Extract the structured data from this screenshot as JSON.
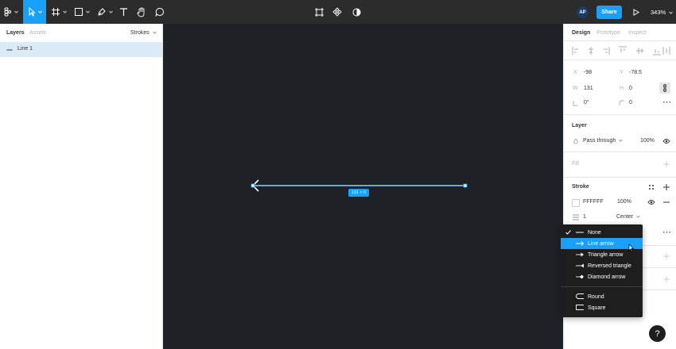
{
  "toolbar": {
    "tools": [
      {
        "name": "main-menu",
        "icon": "figma-logo-icon"
      },
      {
        "name": "move-tool",
        "icon": "cursor-arrow-icon",
        "active": true
      },
      {
        "name": "frame-tool",
        "icon": "frame-hash-icon"
      },
      {
        "name": "shape-tool",
        "icon": "rectangle-icon"
      },
      {
        "name": "pen-tool",
        "icon": "pen-icon"
      },
      {
        "name": "text-tool",
        "icon": "text-t-icon"
      },
      {
        "name": "hand-tool",
        "icon": "hand-icon"
      },
      {
        "name": "comment-tool",
        "icon": "comment-bubble-icon"
      }
    ],
    "center_tools": [
      "crop-icon",
      "component-icon",
      "contrast-icon"
    ],
    "avatar_initials": "AP",
    "share_label": "Share",
    "zoom": "343%"
  },
  "left_panel": {
    "tabs": {
      "layers": "Layers",
      "assets": "Assets"
    },
    "page_selector": "Strokes",
    "layers": [
      {
        "name": "Line 1",
        "selected": true
      }
    ]
  },
  "canvas": {
    "background": "#1e2226",
    "selection_size_label": "131 × 0"
  },
  "right_panel": {
    "tabs": {
      "design": "Design",
      "prototype": "Prototype",
      "inspect": "Inspect"
    },
    "position": {
      "x_label": "X",
      "x": "-98",
      "y_label": "Y",
      "y": "-78.5"
    },
    "size": {
      "w_label": "W",
      "w": "131",
      "h_label": "H",
      "h": "0"
    },
    "rotation": "0°",
    "corner_radius": "0",
    "layer": {
      "title": "Layer",
      "blend_mode": "Pass through",
      "opacity": "100%"
    },
    "fill": {
      "title": "Fill"
    },
    "stroke": {
      "title": "Stroke",
      "color": "FFFFFF",
      "opacity": "100%",
      "weight": "1",
      "align": "Center"
    }
  },
  "dropdown": {
    "items": [
      {
        "label": "None",
        "checked": true,
        "icon": "line-none-icon"
      },
      {
        "label": "Line arrow",
        "highlighted": true,
        "icon": "line-arrow-icon"
      },
      {
        "label": "Triangle arrow",
        "icon": "triangle-arrow-icon"
      },
      {
        "label": "Reversed triangle",
        "icon": "reversed-triangle-icon"
      },
      {
        "label": "Diamond arrow",
        "icon": "diamond-arrow-icon"
      },
      {
        "label": "Round",
        "icon": "round-cap-icon"
      },
      {
        "label": "Square",
        "icon": "square-cap-icon"
      }
    ]
  },
  "help": {
    "label": "?"
  },
  "colors": {
    "accent": "#18a0fb",
    "toolbar": "#2c2c2c",
    "menu": "#1e1e1e"
  }
}
